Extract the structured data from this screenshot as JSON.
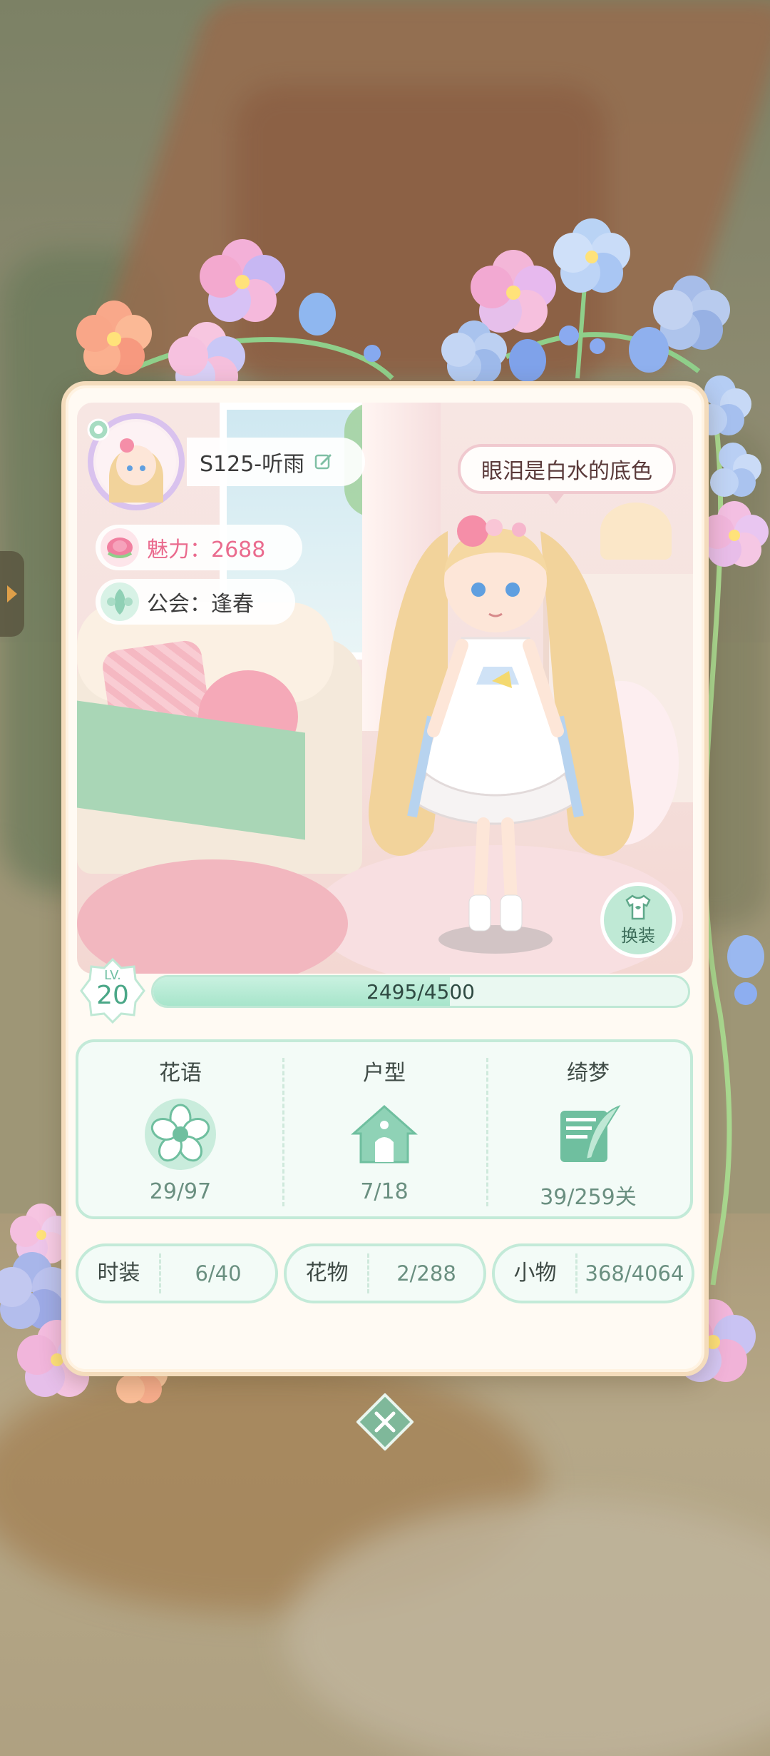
{
  "profile": {
    "name": "S125-听雨",
    "charm_label": "魅力：2688",
    "guild_label": "公会：逢春",
    "signature": "眼泪是白水的底色"
  },
  "outfit_button": {
    "label": "换装"
  },
  "level": {
    "lv_label": "LV.",
    "lv_value": "20",
    "xp_text": "2495/4500",
    "xp_fraction": 0.5544
  },
  "collections": [
    {
      "title": "花语",
      "value": "29/97",
      "icon": "flower-icon"
    },
    {
      "title": "户型",
      "value": "7/18",
      "icon": "house-icon"
    },
    {
      "title": "绮梦",
      "value": "39/259关",
      "icon": "letter-quill-icon"
    }
  ],
  "counts": [
    {
      "label": "时装",
      "value": "6/40"
    },
    {
      "label": "花物",
      "value": "2/288"
    },
    {
      "label": "小物",
      "value": "368/4064"
    }
  ],
  "colors": {
    "accent_green": "#a7e5cb",
    "charm_pink": "#ea6b8e",
    "card_border": "#f4dcbc"
  }
}
